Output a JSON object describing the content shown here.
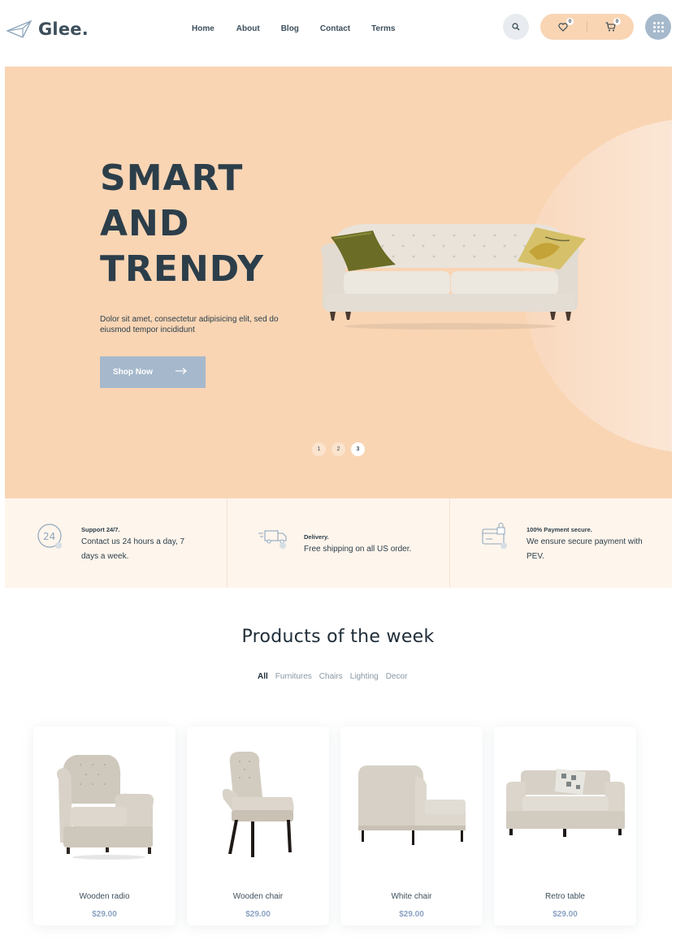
{
  "header": {
    "logo_text": "Glee.",
    "nav": [
      "Home",
      "About",
      "Blog",
      "Contact",
      "Terms"
    ],
    "wishlist_count": "0",
    "cart_count": "0"
  },
  "hero": {
    "title_lines": [
      "SMART",
      "AND",
      "TRENDY"
    ],
    "description": "Dolor sit amet, consectetur adipisicing elit, sed do eiusmod tempor incididunt",
    "button_label": "Shop Now",
    "slides": [
      "1",
      "2",
      "3"
    ],
    "active_slide": "3"
  },
  "features": [
    {
      "icon": "support-24-icon",
      "title": "Support 24/7.",
      "text": "Contact us 24 hours a day, 7 days a week."
    },
    {
      "icon": "delivery-truck-icon",
      "title": "Delivery.",
      "text": "Free shipping on all US order."
    },
    {
      "icon": "secure-payment-icon",
      "title": "100% Payment secure.",
      "text": "We ensure secure payment with PEV."
    }
  ],
  "products_section": {
    "title": "Products of the week",
    "filters": [
      "All",
      "Furnitures",
      "Chairs",
      "Lighting",
      "Decor"
    ],
    "active_filter": "All",
    "products": [
      {
        "name": "Wooden radio",
        "price": "$29.00"
      },
      {
        "name": "Wooden chair",
        "price": "$29.00"
      },
      {
        "name": "White chair",
        "price": "$29.00"
      },
      {
        "name": "Retro table",
        "price": "$29.00"
      }
    ]
  },
  "colors": {
    "hero_bg": "#f9d5b4",
    "accent_blue": "#a6b9cc",
    "text_dark": "#2c3e4a",
    "price": "#8ba3c4"
  }
}
